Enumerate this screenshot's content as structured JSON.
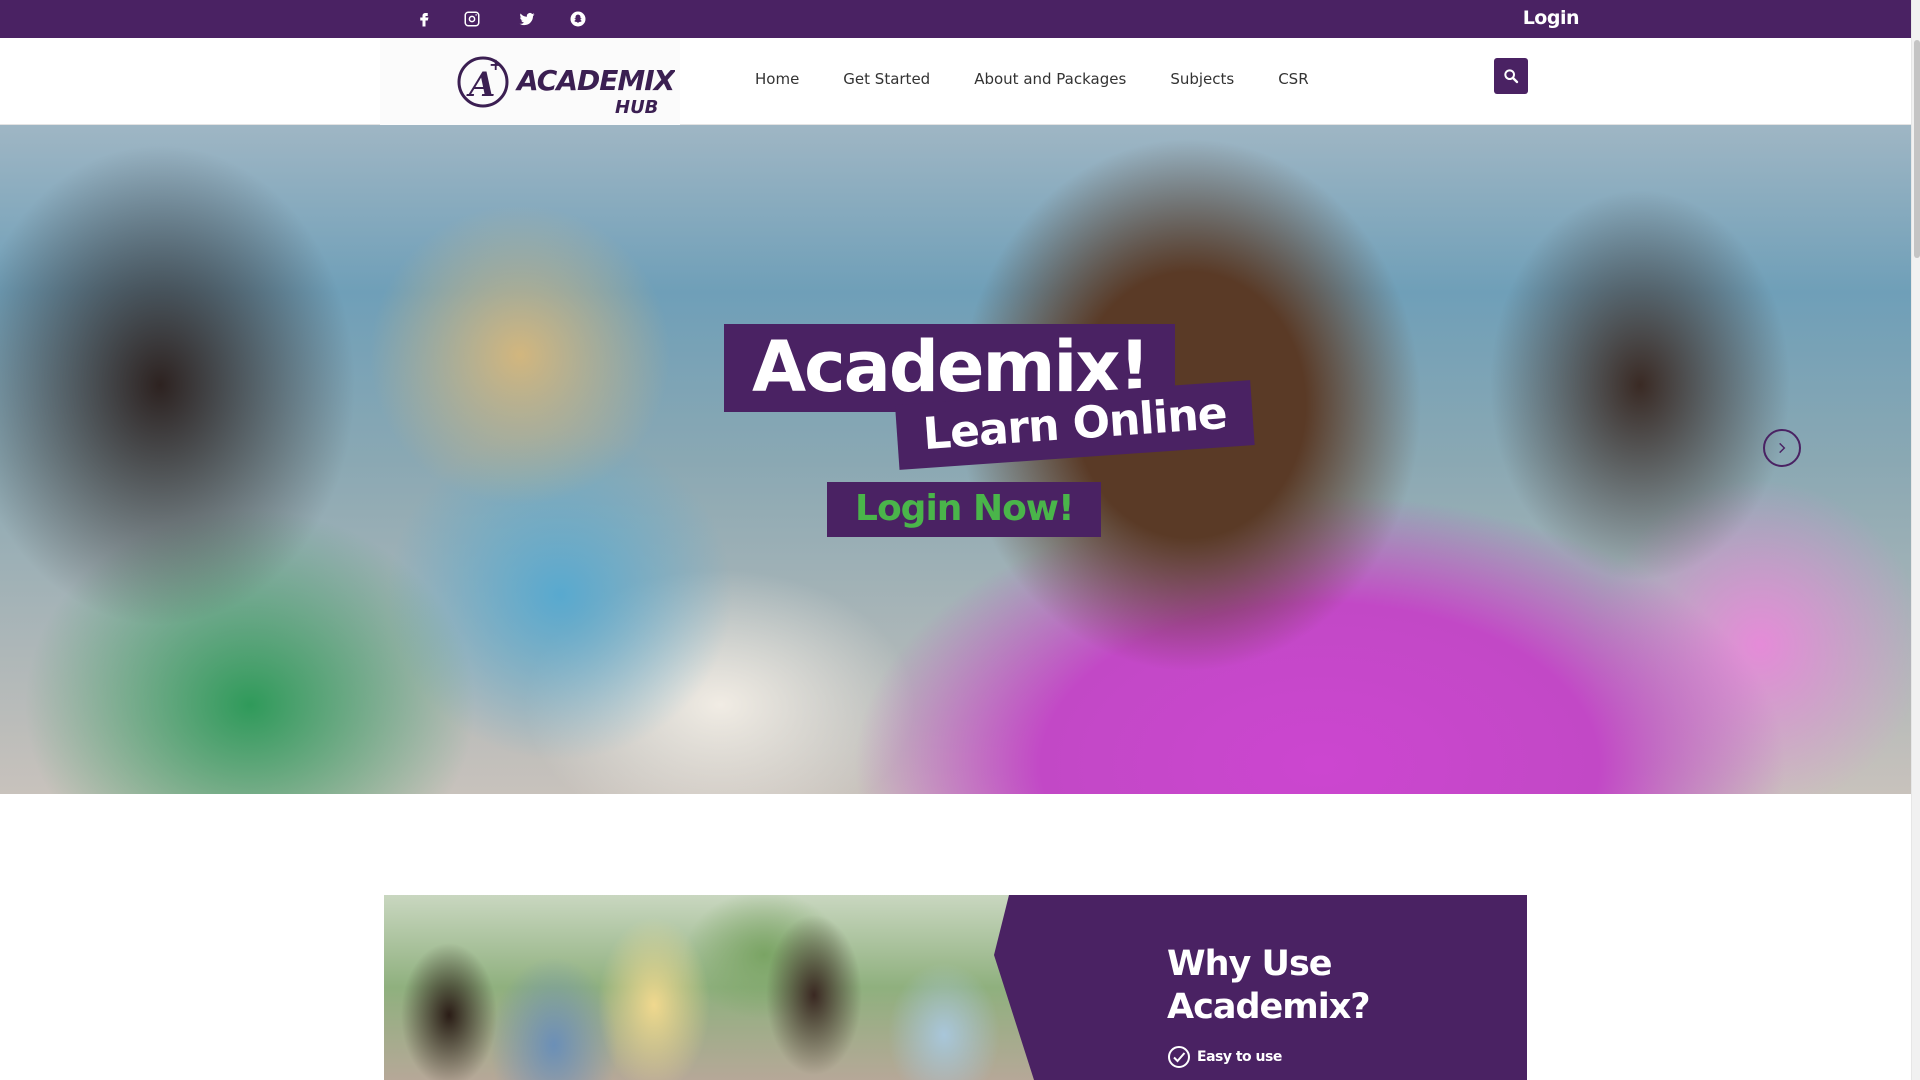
{
  "topbar": {
    "social": [
      {
        "icon": "facebook-icon"
      },
      {
        "icon": "instagram-icon"
      },
      {
        "icon": "twitter-icon"
      },
      {
        "icon": "snapchat-icon"
      }
    ],
    "login_label": "Login"
  },
  "header": {
    "logo": {
      "brand": "ACADEMIX",
      "sub": "HUB",
      "mark": "A"
    },
    "nav": [
      {
        "label": "Home"
      },
      {
        "label": "Get Started"
      },
      {
        "label": "About and Packages"
      },
      {
        "label": "Subjects"
      },
      {
        "label": "CSR"
      }
    ],
    "search_icon": "search-icon"
  },
  "hero": {
    "title": "Academix!",
    "subtitle": "Learn Online",
    "cta": "Login Now!",
    "next_icon": "chevron-right-icon"
  },
  "why": {
    "title_line1": "Why Use",
    "title_line2": "Academix?",
    "items": [
      {
        "label": "Easy to use",
        "icon": "check-circle-icon"
      }
    ]
  },
  "colors": {
    "brand_purple": "#4a2263",
    "cta_green": "#4ab54a",
    "white": "#ffffff"
  }
}
